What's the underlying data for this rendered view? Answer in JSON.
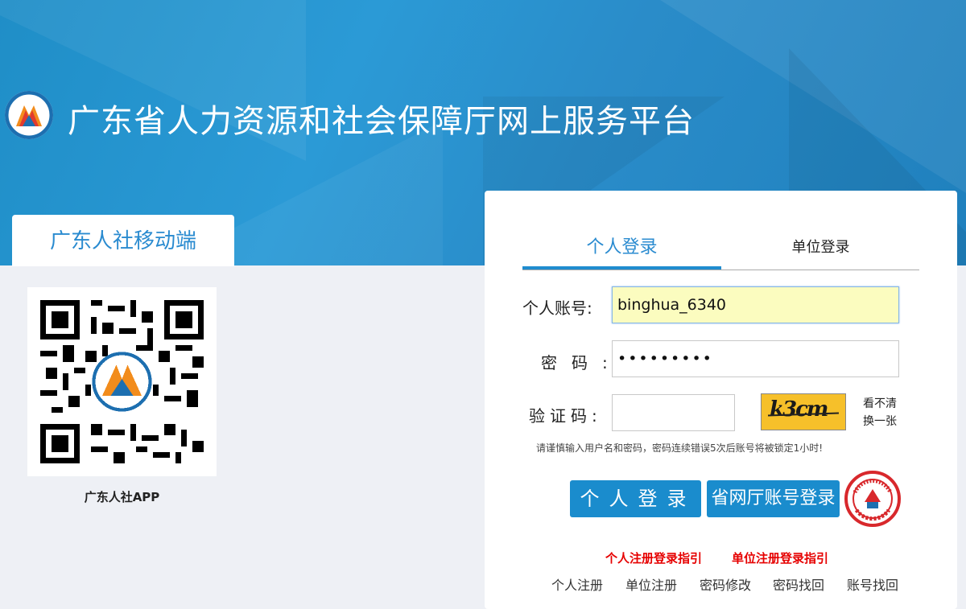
{
  "header": {
    "site_title": "广东省人力资源和社会保障厅网上服务平台",
    "logo_icon": "gd-hrss-logo-icon"
  },
  "mobile": {
    "tab_label": "广东人社移动端",
    "qr_icon": "qr-code-icon",
    "app_label": "广东人社APP"
  },
  "login": {
    "tabs": [
      {
        "label": "个人登录",
        "active": true
      },
      {
        "label": "单位登录",
        "active": false
      }
    ],
    "account_label": "个人账号:",
    "account_value": "binghua_6340",
    "password_label": "密码:",
    "password_value": "•••••••••",
    "captcha_label": "验证码:",
    "captcha_value": "",
    "captcha_text": "k3cm",
    "refresh_text": "看不清 换一张",
    "warning": "请谨慎输入用户名和密码，密码连续错误5次后账号将被锁定1小时!",
    "personal_login_button": "个人登录",
    "province_login_button": "省网厅账号登录",
    "ss_badge_icon": "social-security-card-icon",
    "guide_links": [
      "个人注册登录指引",
      "单位注册登录指引"
    ],
    "bottom_links": [
      "个人注册",
      "单位注册",
      "密码修改",
      "密码找回",
      "账号找回"
    ]
  },
  "colors": {
    "banner_blue": "#2a93d2",
    "button_blue": "#1a8ccd",
    "guide_red": "#e60000",
    "account_bg": "#fbfcbf"
  }
}
